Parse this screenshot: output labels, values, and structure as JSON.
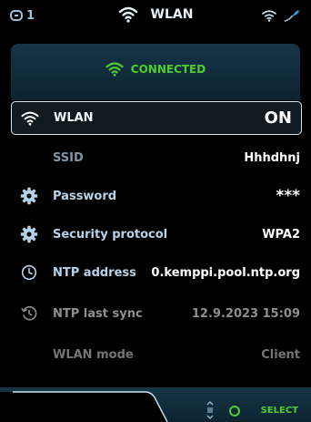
{
  "statusbar": {
    "device_number": "1",
    "title": "WLAN"
  },
  "banner": {
    "status": "CONNECTED",
    "accent_color": "#4bcf2f"
  },
  "rows": [
    {
      "icon": "wifi-icon",
      "label": "WLAN",
      "value": "ON"
    },
    {
      "icon": "",
      "label": "SSID",
      "value": "Hhhdhnj"
    },
    {
      "icon": "gear-icon",
      "label": "Password",
      "value": "***"
    },
    {
      "icon": "gear-icon",
      "label": "Security protocol",
      "value": "WPA2"
    },
    {
      "icon": "clock-icon",
      "label": "NTP address",
      "value": "0.kemppi.pool.ntp.org"
    },
    {
      "icon": "history-icon",
      "label": "NTP last sync",
      "value": "12.9.2023 15:09"
    },
    {
      "icon": "",
      "label": "WLAN mode",
      "value": "Client"
    }
  ],
  "bottombar": {
    "select_label": "SELECT"
  }
}
